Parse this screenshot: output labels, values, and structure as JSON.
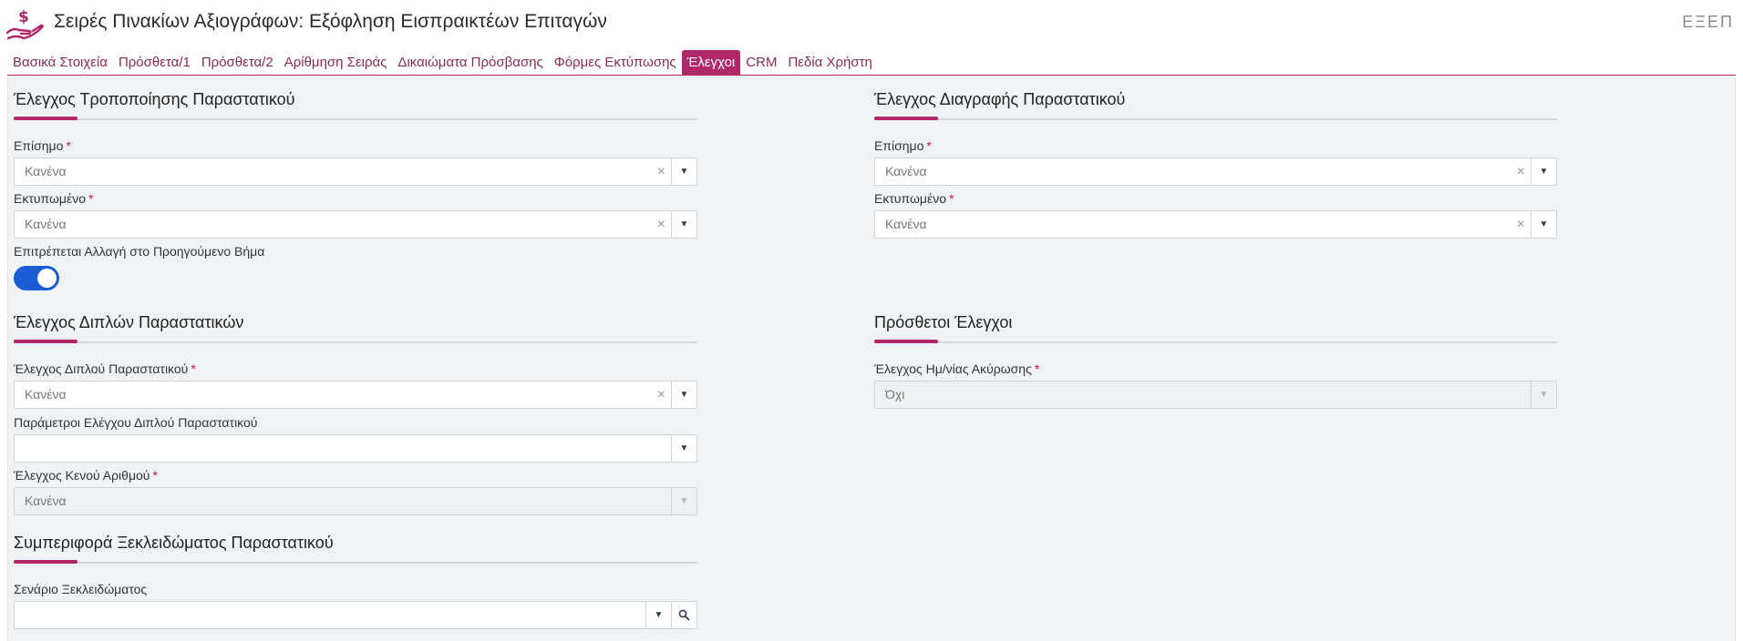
{
  "header": {
    "title": "Σειρές Πινακίων Αξιογράφων: Εξόφληση Εισπραικτέων Επιταγών",
    "exit_label": "ΕΞΕΠ",
    "logo_icon": "hand-with-dollar-icon",
    "accent_color": "#b0286a"
  },
  "tabs": [
    {
      "label": "Βασικά Στοιχεία",
      "active": false
    },
    {
      "label": "Πρόσθετα/1",
      "active": false
    },
    {
      "label": "Πρόσθετα/2",
      "active": false
    },
    {
      "label": "Αρίθμηση Σειράς",
      "active": false
    },
    {
      "label": "Δικαιώματα Πρόσβασης",
      "active": false
    },
    {
      "label": "Φόρμες Εκτύπωσης",
      "active": false
    },
    {
      "label": "Έλεγχοι",
      "active": true
    },
    {
      "label": "CRM",
      "active": false
    },
    {
      "label": "Πεδία Χρήστη",
      "active": false
    }
  ],
  "sections": {
    "modify": {
      "title": "Έλεγχος Τροποποίησης Παραστατικού",
      "official": {
        "label": "Επίσημο",
        "required": "*",
        "value": "Κανένα",
        "clear": "×"
      },
      "printed": {
        "label": "Εκτυπωμένο",
        "required": "*",
        "value": "Κανένα",
        "clear": "×"
      },
      "allow_prev_step": {
        "label": "Επιτρέπεται Αλλαγή στο Προηγούμενο Βήμα",
        "enabled": true
      }
    },
    "delete": {
      "title": "Έλεγχος Διαγραφής Παραστατικού",
      "official": {
        "label": "Επίσημο",
        "required": "*",
        "value": "Κανένα",
        "clear": "×"
      },
      "printed": {
        "label": "Εκτυπωμένο",
        "required": "*",
        "value": "Κανένα",
        "clear": "×"
      }
    },
    "duplicates": {
      "title": "Έλεγχος Διπλών Παραστατικών",
      "duplicate_check": {
        "label": "Έλεγχος Διπλού Παραστατικού",
        "required": "*",
        "value": "Κανένα",
        "clear": "×"
      },
      "duplicate_params": {
        "label": "Παράμετροι Ελέγχου Διπλού Παραστατικού",
        "value": ""
      },
      "empty_number": {
        "label": "Έλεγχος Κενού Αριθμού",
        "required": "*",
        "value": "Κανένα"
      }
    },
    "extra": {
      "title": "Πρόσθετοι Έλεγχοι",
      "cancel_date": {
        "label": "Έλεγχος Ημ/νίας Ακύρωσης",
        "required": "*",
        "value": "Όχι"
      }
    },
    "unlock": {
      "title": "Συμπεριφορά Ξεκλειδώματος Παραστατικού",
      "scenario": {
        "label": "Σενάριο Ξεκλειδώματος",
        "value": ""
      }
    }
  }
}
